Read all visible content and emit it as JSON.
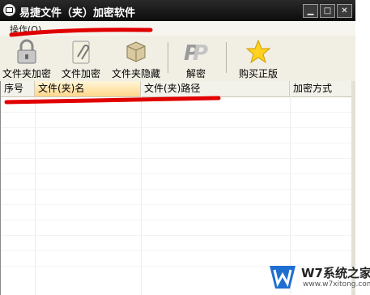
{
  "window": {
    "title": "易捷文件（夹）加密软件",
    "controls": {
      "minimize": "▁",
      "maximize": "□",
      "close": "✕"
    }
  },
  "menubar": {
    "items": [
      {
        "label": "操作(O)"
      }
    ]
  },
  "toolbar": {
    "buttons": [
      {
        "label": "文件夹加密",
        "icon": "padlock-icon"
      },
      {
        "label": "文件加密",
        "icon": "paperclip-document-icon"
      },
      {
        "label": "文件夹隐藏",
        "icon": "box-icon"
      },
      {
        "label": "解密",
        "icon": "p-logo-icon"
      },
      {
        "label": "购买正版",
        "icon": "star-icon"
      }
    ]
  },
  "table": {
    "columns": [
      "序号",
      "文件(夹)名",
      "文件(夹)路径",
      "加密方式"
    ],
    "rows": []
  },
  "watermark": {
    "title": "W7系统之家",
    "url": "www.w7xitong.com"
  },
  "colors": {
    "titlebar": "#1a1a1a",
    "toolbar_bg": "#f1efe4",
    "header_active": "#ffd78a",
    "annotation_red": "#e00000",
    "watermark_blue": "#1f6fd1"
  }
}
